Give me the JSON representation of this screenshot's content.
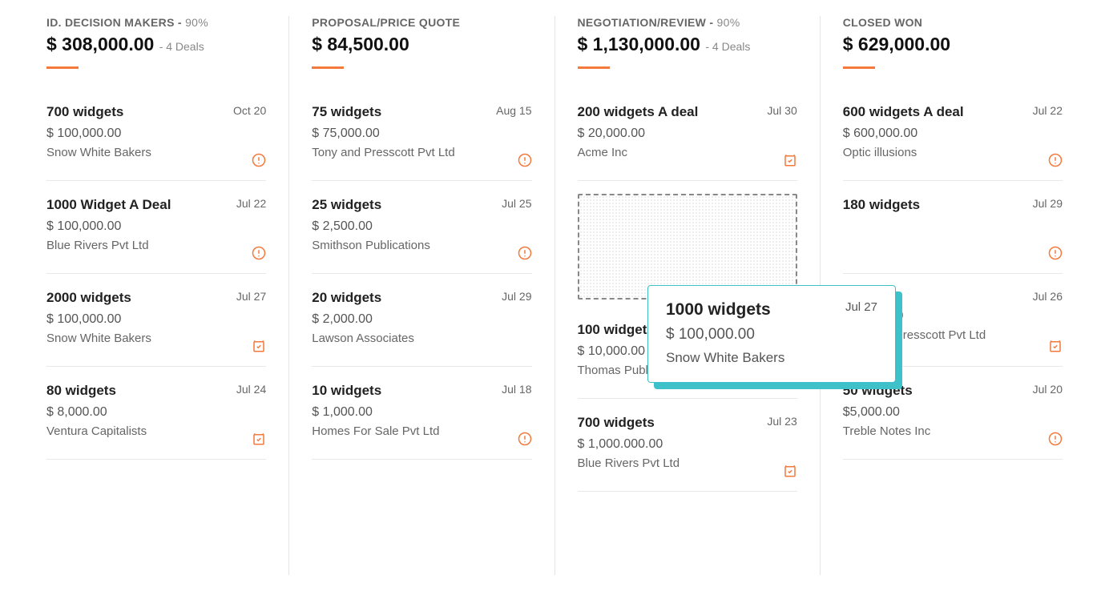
{
  "dragging_card": {
    "name": "1000 widgets",
    "date": "Jul 27",
    "amount": "$ 100,000.00",
    "company": "Snow White Bakers"
  },
  "columns": [
    {
      "title": "ID. DECISION MAKERS",
      "pct": "90%",
      "amount": "$ 308,000.00",
      "deals": "4 Deals",
      "cards": [
        {
          "name": "700 widgets",
          "date": "Oct 20",
          "amount": "$ 100,000.00",
          "company": "Snow White Bakers",
          "icon": "alert"
        },
        {
          "name": "1000 Widget A Deal",
          "date": "Jul 22",
          "amount": "$ 100,000.00",
          "company": "Blue Rivers Pvt Ltd",
          "icon": "alert"
        },
        {
          "name": "2000 widgets",
          "date": "Jul 27",
          "amount": "$ 100,000.00",
          "company": "Snow White Bakers",
          "icon": "check"
        },
        {
          "name": "80 widgets",
          "date": "Jul 24",
          "amount": "$ 8,000.00",
          "company": "Ventura Capitalists",
          "icon": "check"
        }
      ]
    },
    {
      "title": "PROPOSAL/PRICE QUOTE",
      "pct": "",
      "amount": "$ 84,500.00",
      "deals": "",
      "cards": [
        {
          "name": "75 widgets",
          "date": "Aug 15",
          "amount": "$ 75,000.00",
          "company": "Tony and Presscott Pvt Ltd",
          "icon": "alert"
        },
        {
          "name": "25 widgets",
          "date": "Jul 25",
          "amount": "$ 2,500.00",
          "company": "Smithson Publications",
          "icon": "alert"
        },
        {
          "name": "20 widgets",
          "date": "Jul 29",
          "amount": "$ 2,000.00",
          "company": "Lawson Associates",
          "icon": ""
        },
        {
          "name": "10 widgets",
          "date": "Jul 18",
          "amount": "$ 1,000.00",
          "company": "Homes For Sale Pvt Ltd",
          "icon": "alert"
        }
      ]
    },
    {
      "title": "NEGOTIATION/REVIEW",
      "pct": "90%",
      "amount": "$ 1,130,000.00",
      "deals": "4 Deals",
      "cards": [
        {
          "name": "200 widgets A deal",
          "date": "Jul 30",
          "amount": "$ 20,000.00",
          "company": "Acme Inc",
          "icon": "check"
        },
        {
          "drop": true
        },
        {
          "name": "100 widgets",
          "date": "",
          "amount": "$ 10,000.00",
          "company": "Thomas Publishers",
          "icon": "check"
        },
        {
          "name": "700 widgets",
          "date": "Jul 23",
          "amount": "$ 1,000.000.00",
          "company": "Blue Rivers Pvt Ltd",
          "icon": "check"
        }
      ]
    },
    {
      "title": "CLOSED WON",
      "pct": "",
      "amount": "$ 629,000.00",
      "deals": "",
      "cards": [
        {
          "name": "600 widgets A deal",
          "date": "Jul 22",
          "amount": "$ 600,000.00",
          "company": "Optic illusions",
          "icon": "alert"
        },
        {
          "name": "180 widgets",
          "date": "Jul 29",
          "amount": "",
          "company": "",
          "icon": "alert"
        },
        {
          "name": "",
          "date": "Jul 26",
          "amount": "$ 6,000.00",
          "company": "Tony and Presscott Pvt Ltd",
          "icon": "check"
        },
        {
          "name": "50 widgets",
          "date": "Jul 20",
          "amount": "$5,000.00",
          "company": "Treble Notes Inc",
          "icon": "alert"
        }
      ]
    }
  ]
}
